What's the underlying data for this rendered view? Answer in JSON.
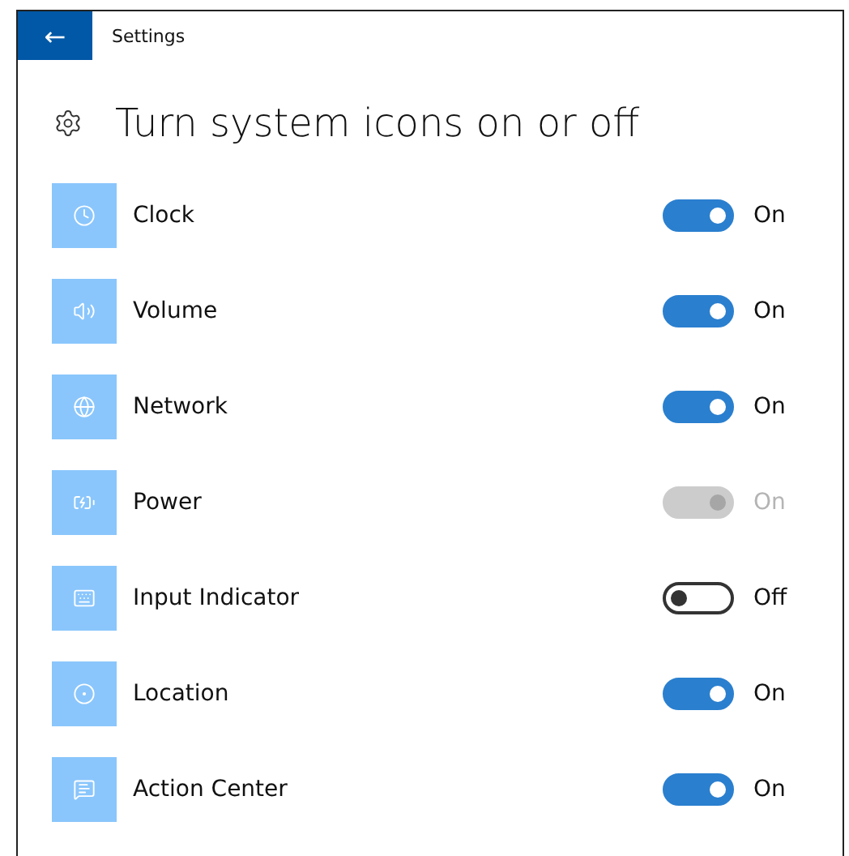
{
  "window": {
    "title": "Settings",
    "back_button": "←"
  },
  "heading": "Turn system icons on or off",
  "items": [
    {
      "label": "Clock",
      "on": true,
      "disabled": false,
      "status": "On"
    },
    {
      "label": "Volume",
      "on": true,
      "disabled": false,
      "status": "On"
    },
    {
      "label": "Network",
      "on": true,
      "disabled": false,
      "status": "On"
    },
    {
      "label": "Power",
      "on": true,
      "disabled": true,
      "status": "On"
    },
    {
      "label": "Input Indicator",
      "on": false,
      "disabled": false,
      "status": "Off"
    },
    {
      "label": "Location",
      "on": true,
      "disabled": false,
      "status": "On"
    },
    {
      "label": "Action Center",
      "on": true,
      "disabled": false,
      "status": "On"
    }
  ]
}
